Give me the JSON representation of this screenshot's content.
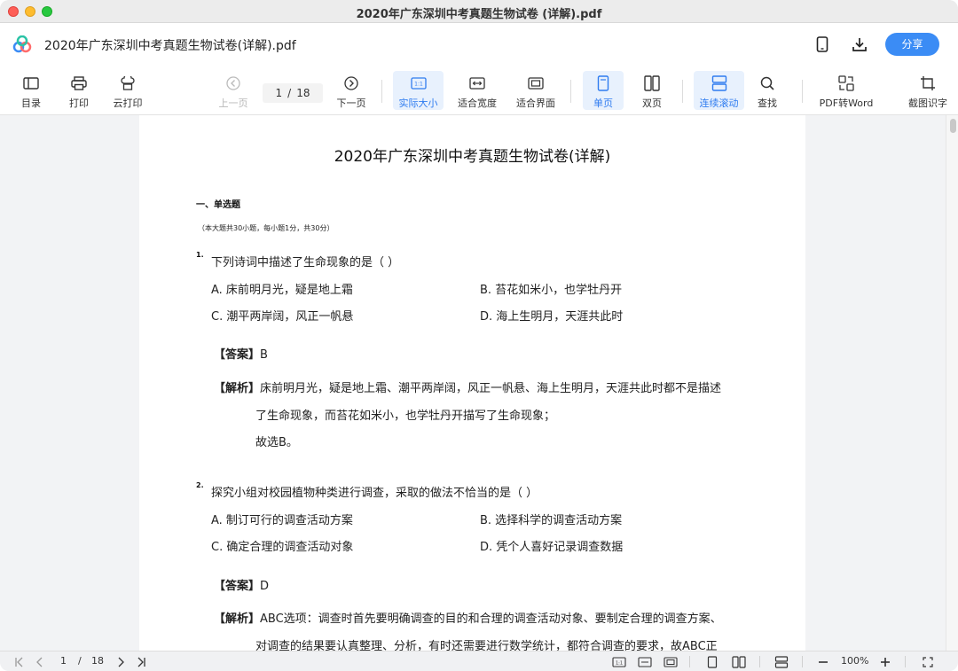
{
  "window": {
    "title": "2020年广东深圳中考真题生物试卷 (详解).pdf"
  },
  "header": {
    "doc_title": "2020年广东深圳中考真题生物试卷(详解).pdf",
    "share_label": "分享"
  },
  "toolbar": {
    "toc": "目录",
    "print": "打印",
    "cloud_print": "云打印",
    "prev_page": "上一页",
    "current_page": "1",
    "page_sep": "/",
    "total_pages": "18",
    "next_page": "下一页",
    "actual_size": "实际大小",
    "fit_width": "适合宽度",
    "fit_page": "适合界面",
    "single_page": "单页",
    "double_page": "双页",
    "continuous_scroll": "连续滚动",
    "find": "查找",
    "pdf_to_word": "PDF转Word",
    "ocr": "截图识字"
  },
  "document": {
    "title": "2020年广东深圳中考真题生物试卷(详解)",
    "section_heading": "一、单选题",
    "section_note": "（本大题共30小题，每小题1分，共30分）",
    "questions": [
      {
        "number": "1.",
        "text": "下列诗词中描述了生命现象的是（    ）",
        "options": [
          "A. 床前明月光，疑是地上霜",
          "B. 苔花如米小，也学牡丹开",
          "C. 潮平两岸阔，风正一帆悬",
          "D. 海上生明月，天涯共此时"
        ],
        "answer_label": "【答案】",
        "answer": "B",
        "analysis_label": "【解析】",
        "analysis_lines": [
          "床前明月光，疑是地上霜、潮平两岸阔，风正一帆悬、海上生明月，天涯共此时都不是描述",
          "了生命现象，而苔花如米小，也学牡丹开描写了生命现象；",
          "故选B。"
        ]
      },
      {
        "number": "2.",
        "text": "探究小组对校园植物种类进行调查，采取的做法不恰当的是（    ）",
        "options": [
          "A. 制订可行的调查活动方案",
          "B. 选择科学的调查活动方案",
          "C. 确定合理的调查活动对象",
          "D. 凭个人喜好记录调查数据"
        ],
        "answer_label": "【答案】",
        "answer": "D",
        "analysis_label": "【解析】",
        "analysis_lines": [
          "ABC选项：调查时首先要明确调查的目的和合理的调查活动对象、要制定合理的调查方案、",
          "对调查的结果要认真整理、分析，有时还需要进行数学统计，都符合调查的要求，故ABC正"
        ]
      }
    ]
  },
  "bottombar": {
    "current_page": "1",
    "page_sep": "/",
    "total_pages": "18",
    "zoom": "100%"
  },
  "colors": {
    "accent": "#3b8cf5",
    "active_bg": "#e8f1fd",
    "active_fg": "#2f7cf0"
  }
}
